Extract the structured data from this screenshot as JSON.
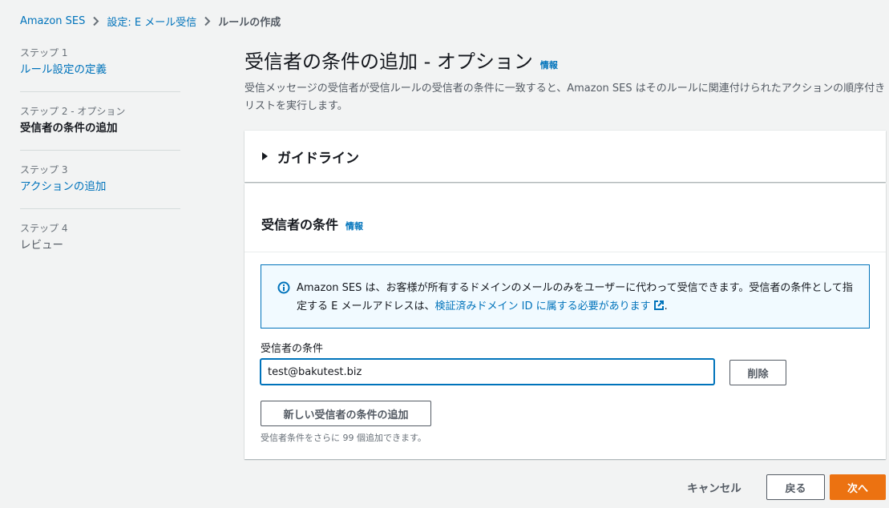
{
  "breadcrumb": {
    "items": [
      "Amazon SES",
      "設定: E メール受信",
      "ルールの作成"
    ]
  },
  "steps": [
    {
      "num": "ステップ 1",
      "title": "ルール設定の定義"
    },
    {
      "num": "ステップ 2 - オプション",
      "title": "受信者の条件の追加"
    },
    {
      "num": "ステップ 3",
      "title": "アクションの追加"
    },
    {
      "num": "ステップ 4",
      "title": "レビュー"
    }
  ],
  "main": {
    "title": "受信者の条件の追加 - オプション",
    "info_label": "情報",
    "description": "受信メッセージの受信者が受信ルールの受信者の条件に一致すると、Amazon SES はそのルールに関連付けられたアクションの順序付きリストを実行します。"
  },
  "guidelines": {
    "title": "ガイドライン"
  },
  "conditions_panel": {
    "title": "受信者の条件",
    "info_label": "情報",
    "alert": {
      "text_before": "Amazon SES は、お客様が所有するドメインのメールのみをユーザーに代わって受信できます。受信者の条件として指定する E メールアドレスは、",
      "link_text": "検証済みドメイン ID に属する必要があります",
      "text_after": "."
    },
    "field_label": "受信者の条件",
    "input_value": "test@bakutest.biz",
    "remove_label": "削除",
    "add_label": "新しい受信者の条件の追加",
    "hint": "受信者条件をさらに 99 個追加できます。"
  },
  "footer": {
    "cancel_label": "キャンセル",
    "back_label": "戻る",
    "next_label": "次へ"
  },
  "colors": {
    "link": "#0073bb",
    "primary_button": "#ec7211",
    "info_background": "#f1faff"
  }
}
